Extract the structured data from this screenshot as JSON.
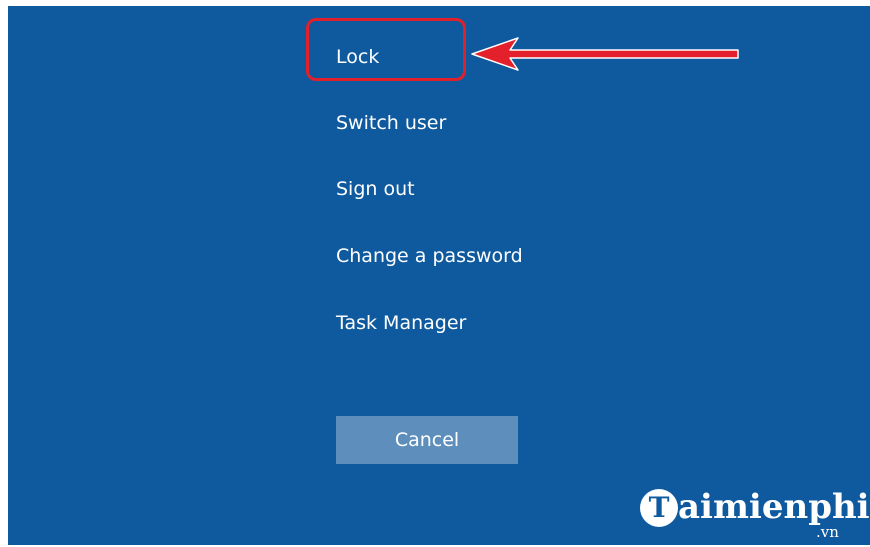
{
  "menu": {
    "items": [
      {
        "label": "Lock"
      },
      {
        "label": "Switch user"
      },
      {
        "label": "Sign out"
      },
      {
        "label": "Change a password"
      },
      {
        "label": "Task Manager"
      }
    ],
    "cancel_label": "Cancel"
  },
  "watermark": {
    "badge": "T",
    "brand": "aimienphi",
    "suffix": ".vn"
  },
  "colors": {
    "background": "#0f5a9e",
    "button": "#5e8fbc",
    "highlight": "#e0202b",
    "text": "#ffffff"
  }
}
